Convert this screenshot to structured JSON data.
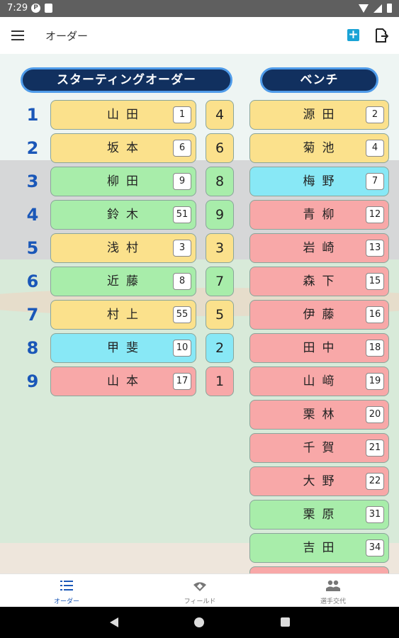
{
  "status_bar": {
    "time": "7:29",
    "p_icon": "P"
  },
  "app_bar": {
    "title": "オーダー"
  },
  "headers": {
    "starting": "スターティングオーダー",
    "bench": "ベンチ"
  },
  "lineup": [
    {
      "order": "1",
      "name": "山田",
      "number": "1",
      "position": "4",
      "color": "yellow"
    },
    {
      "order": "2",
      "name": "坂本",
      "number": "6",
      "position": "6",
      "color": "yellow"
    },
    {
      "order": "3",
      "name": "柳田",
      "number": "9",
      "position": "8",
      "color": "green"
    },
    {
      "order": "4",
      "name": "鈴木",
      "number": "51",
      "position": "9",
      "color": "green"
    },
    {
      "order": "5",
      "name": "浅村",
      "number": "3",
      "position": "3",
      "color": "yellow"
    },
    {
      "order": "6",
      "name": "近藤",
      "number": "8",
      "position": "7",
      "color": "green"
    },
    {
      "order": "7",
      "name": "村上",
      "number": "55",
      "position": "5",
      "color": "yellow"
    },
    {
      "order": "8",
      "name": "甲斐",
      "number": "10",
      "position": "2",
      "color": "cyan"
    },
    {
      "order": "9",
      "name": "山本",
      "number": "17",
      "position": "1",
      "color": "pink"
    }
  ],
  "bench": [
    {
      "name": "源田",
      "number": "2",
      "color": "yellow"
    },
    {
      "name": "菊池",
      "number": "4",
      "color": "yellow"
    },
    {
      "name": "梅野",
      "number": "7",
      "color": "cyan"
    },
    {
      "name": "青柳",
      "number": "12",
      "color": "pink"
    },
    {
      "name": "岩崎",
      "number": "13",
      "color": "pink"
    },
    {
      "name": "森下",
      "number": "15",
      "color": "pink"
    },
    {
      "name": "伊藤",
      "number": "16",
      "color": "pink"
    },
    {
      "name": "田中",
      "number": "18",
      "color": "pink"
    },
    {
      "name": "山﨑",
      "number": "19",
      "color": "pink"
    },
    {
      "name": "栗林",
      "number": "20",
      "color": "pink"
    },
    {
      "name": "千賀",
      "number": "21",
      "color": "pink"
    },
    {
      "name": "大野",
      "number": "22",
      "color": "pink"
    },
    {
      "name": "栗原",
      "number": "31",
      "color": "green"
    },
    {
      "name": "吉田",
      "number": "34",
      "color": "green"
    }
  ],
  "bottom_nav": [
    {
      "label": "オーダー",
      "icon": "list-icon",
      "active": true
    },
    {
      "label": "フィールド",
      "icon": "field-icon",
      "active": false
    },
    {
      "label": "選手交代",
      "icon": "people-icon",
      "active": false
    }
  ],
  "colors": {
    "yellow": "#fbe18c",
    "green": "#a8edaa",
    "cyan": "#88e8f6",
    "pink": "#f8a8a8",
    "header_bg": "#11305f",
    "header_border": "#4f9be9",
    "order_number": "#1a57b8",
    "accent": "#1aa3d6"
  }
}
